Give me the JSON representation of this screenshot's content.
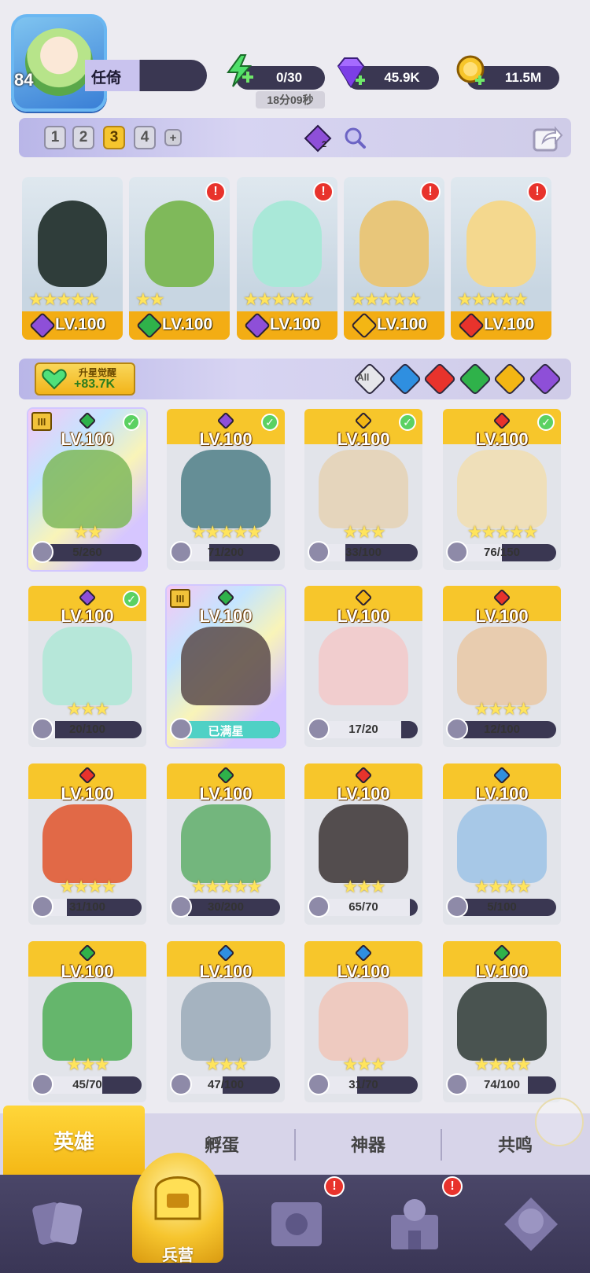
{
  "player": {
    "level": "84",
    "name": "任倚"
  },
  "resources": {
    "energy": "0/30",
    "energy_timer": "18分09秒",
    "gems": "45.9K",
    "gold": "11.5M"
  },
  "team_bar": {
    "slots": [
      "1",
      "2",
      "3",
      "4"
    ],
    "active_slot": "3",
    "add_label": "+",
    "cost_value": "2"
  },
  "team_cards": [
    {
      "level": "LV.100",
      "stars": "★★★★★",
      "element": "dark",
      "element_color": "#8e4fd8",
      "alert": "",
      "art_color": "#2f3d3a"
    },
    {
      "level": "LV.100",
      "stars": "★★",
      "element": "nature",
      "element_color": "#2fb24a",
      "alert": "!",
      "art_color": "#7fb95a"
    },
    {
      "level": "LV.100",
      "stars": "★★★★★",
      "element": "dark",
      "element_color": "#8e4fd8",
      "alert": "!",
      "art_color": "#a9e8d8"
    },
    {
      "level": "LV.100",
      "stars": "★★★★★",
      "element": "light",
      "element_color": "#f3b614",
      "alert": "!",
      "art_color": "#e8c67a"
    },
    {
      "level": "LV.100",
      "stars": "★★★★★",
      "element": "fire",
      "element_color": "#e8332c",
      "alert": "!",
      "art_color": "#f4d88e"
    }
  ],
  "filter": {
    "awaken_title": "升星觉醒",
    "awaken_value": "+83.7K",
    "all_label": "All",
    "elements": [
      {
        "name": "water",
        "color": "#2f8fe0"
      },
      {
        "name": "fire",
        "color": "#e8332c"
      },
      {
        "name": "nature",
        "color": "#2fb24a"
      },
      {
        "name": "light",
        "color": "#f3b614"
      },
      {
        "name": "dark",
        "color": "#8e4fd8"
      }
    ]
  },
  "heroes": [
    {
      "level": "LV.100",
      "stars": "★★",
      "shards": "5/260",
      "fill": 0.02,
      "element_color": "#2fb24a",
      "check": true,
      "rainbow": true,
      "tier": "III",
      "art": "#7fb95a"
    },
    {
      "level": "LV.100",
      "stars": "★★★★★",
      "shards": "71/200",
      "fill": 0.35,
      "element_color": "#8e4fd8",
      "check": true,
      "art": "#4f7f87"
    },
    {
      "level": "LV.100",
      "stars": "★★★",
      "shards": "33/100",
      "fill": 0.33,
      "element_color": "#f3b614",
      "check": true,
      "art": "#e5d2b4"
    },
    {
      "level": "LV.100",
      "stars": "★★★★★",
      "shards": "76/150",
      "fill": 0.5,
      "element_color": "#e8332c",
      "check": true,
      "art": "#f1deb0"
    },
    {
      "level": "LV.100",
      "stars": "★★★",
      "shards": "20/100",
      "fill": 0.2,
      "element_color": "#8e4fd8",
      "check": true,
      "art": "#aee7d6"
    },
    {
      "level": "LV.100",
      "stars": "",
      "shards": "已满星",
      "fill": 1,
      "full": true,
      "element_color": "#2fb24a",
      "check": false,
      "rainbow": true,
      "tier": "III",
      "art": "#5a4a4a"
    },
    {
      "level": "LV.100",
      "stars": "",
      "shards": "17/20",
      "fill": 0.85,
      "element_color": "#f3b614",
      "check": false,
      "art": "#f3c9c9"
    },
    {
      "level": "LV.100",
      "stars": "★★★★",
      "shards": "12/100",
      "fill": 0.12,
      "element_color": "#e8332c",
      "check": false,
      "art": "#e9c8a5"
    },
    {
      "level": "LV.100",
      "stars": "★★★★",
      "shards": "31/100",
      "fill": 0.31,
      "element_color": "#e8332c",
      "check": false,
      "art": "#e0532a"
    },
    {
      "level": "LV.100",
      "stars": "★★★★★",
      "shards": "30/200",
      "fill": 0.15,
      "element_color": "#2fb24a",
      "check": false,
      "art": "#5fae6a"
    },
    {
      "level": "LV.100",
      "stars": "★★★",
      "shards": "65/70",
      "fill": 0.93,
      "element_color": "#e8332c",
      "check": false,
      "art": "#3a3232"
    },
    {
      "level": "LV.100",
      "stars": "★★★★",
      "shards": "5/100",
      "fill": 0.05,
      "element_color": "#2f8fe0",
      "check": false,
      "art": "#9cc3e6"
    },
    {
      "level": "LV.100",
      "stars": "★★★",
      "shards": "45/70",
      "fill": 0.64,
      "element_color": "#2fb24a",
      "check": false,
      "art": "#4fae56"
    },
    {
      "level": "LV.100",
      "stars": "★★★",
      "shards": "47/100",
      "fill": 0.47,
      "element_color": "#2f8fe0",
      "check": false,
      "art": "#9aaab8"
    },
    {
      "level": "LV.100",
      "stars": "★★★",
      "shards": "31/70",
      "fill": 0.44,
      "element_color": "#2f8fe0",
      "check": false,
      "art": "#f0c5b8"
    },
    {
      "level": "LV.100",
      "stars": "★★★★",
      "shards": "74/100",
      "fill": 0.74,
      "element_color": "#2fb24a",
      "check": false,
      "art": "#2e3a35"
    }
  ],
  "subtabs": [
    "英雄",
    "孵蛋",
    "神器",
    "共鸣"
  ],
  "bottom_nav": {
    "active_label": "兵营",
    "alert": "!"
  }
}
